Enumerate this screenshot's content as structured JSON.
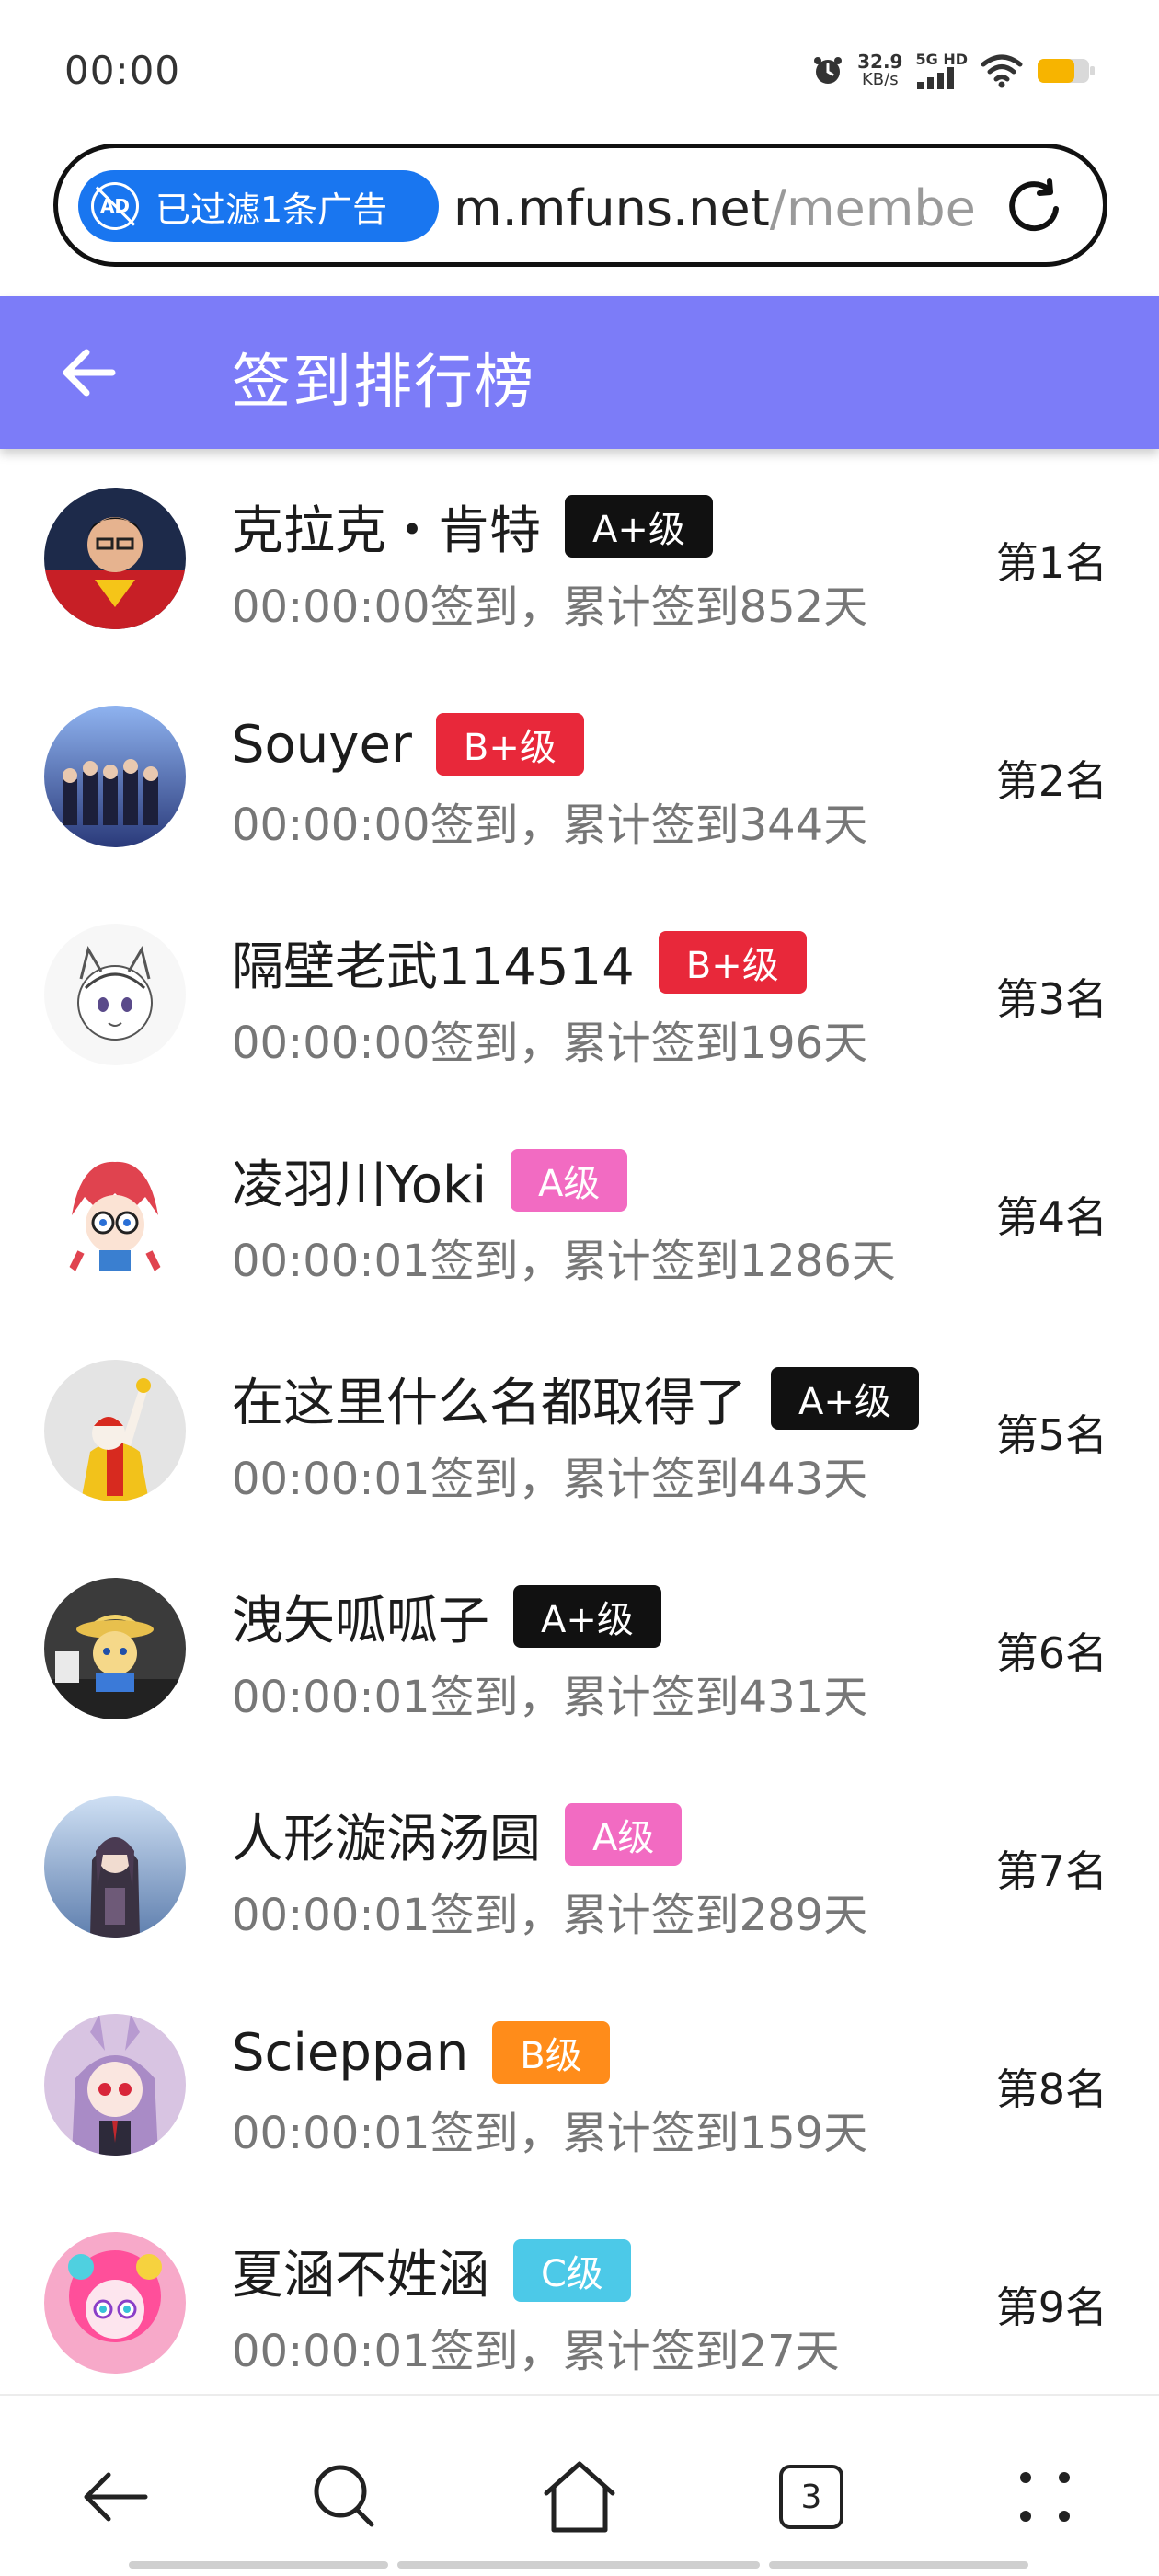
{
  "status_bar": {
    "time": "00:00",
    "net_speed_value": "32.9",
    "net_speed_unit": "KB/s",
    "network_label": "5G HD",
    "battery_color": "#f7b400"
  },
  "url_bar": {
    "ad_filter_label": "已过滤1条广告",
    "ad_icon_text": "AD",
    "url_host": "m.mfuns.net",
    "url_path": "/membe"
  },
  "header": {
    "title": "签到排行榜",
    "accent_color": "#7c7cf8"
  },
  "ranking": [
    {
      "name": "克拉克・肯特",
      "level": "A+级",
      "level_color": "#111111",
      "checkin": "00:00:00签到，累计签到852天",
      "rank": "第1名"
    },
    {
      "name": "Souyer",
      "level": "B+级",
      "level_color": "#e8283a",
      "checkin": "00:00:00签到，累计签到344天",
      "rank": "第2名"
    },
    {
      "name": "隔壁老武114514",
      "level": "B+级",
      "level_color": "#e8283a",
      "checkin": "00:00:00签到，累计签到196天",
      "rank": "第3名"
    },
    {
      "name": "凌羽川Yoki",
      "level": "A级",
      "level_color": "#f26bc2",
      "checkin": "00:00:01签到，累计签到1286天",
      "rank": "第4名"
    },
    {
      "name": "在这里什么名都取得了",
      "level": "A+级",
      "level_color": "#111111",
      "checkin": "00:00:01签到，累计签到443天",
      "rank": "第5名"
    },
    {
      "name": "洩矢呱呱子",
      "level": "A+级",
      "level_color": "#111111",
      "checkin": "00:00:01签到，累计签到431天",
      "rank": "第6名"
    },
    {
      "name": "人形漩涡汤圆",
      "level": "A级",
      "level_color": "#f26bc2",
      "checkin": "00:00:01签到，累计签到289天",
      "rank": "第7名"
    },
    {
      "name": "Scieppan",
      "level": "B级",
      "level_color": "#ff8c1a",
      "checkin": "00:00:01签到，累计签到159天",
      "rank": "第8名"
    },
    {
      "name": "夏涵不姓涵",
      "level": "C级",
      "level_color": "#4cc9e8",
      "checkin": "00:00:01签到，累计签到27天",
      "rank": "第9名"
    }
  ],
  "bottom_nav": {
    "tab_count": "3"
  }
}
